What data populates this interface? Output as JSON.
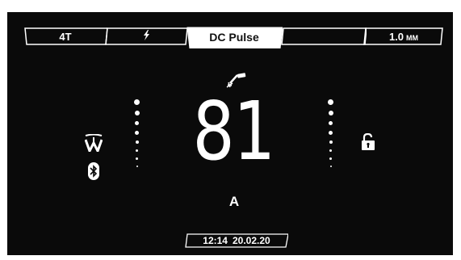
{
  "tabs": [
    {
      "label": "4T",
      "active": false
    },
    {
      "icon": "lightning-icon",
      "active": false
    },
    {
      "label": "DC Pulse",
      "active": true
    },
    {
      "label": "",
      "active": false
    },
    {
      "label": "1.0",
      "unit": "MM",
      "active": false
    }
  ],
  "main": {
    "value": "81",
    "unit": "A",
    "process_icon": "torch-icon"
  },
  "left_icons": [
    "tungsten-icon",
    "bluetooth-icon"
  ],
  "right_icons": [
    "unlocked-padlock-icon"
  ],
  "status": {
    "time": "12:14",
    "date": "20.02.20"
  },
  "colors": {
    "background": "#0a0a0a",
    "foreground": "#ffffff",
    "active_tab": "#ffffff"
  }
}
